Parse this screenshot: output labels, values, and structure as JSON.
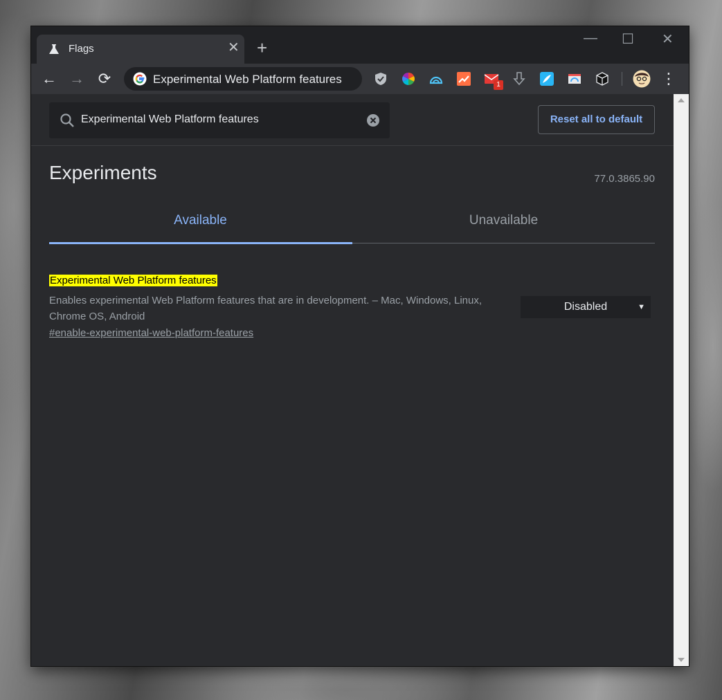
{
  "tab": {
    "title": "Flags",
    "close_glyph": "✕"
  },
  "newtab_glyph": "+",
  "window_controls": {
    "minimize": "—",
    "maximize": "☐",
    "close": "✕"
  },
  "toolbar": {
    "back": "←",
    "forward": "→",
    "reload": "⟳",
    "omnibox_text": "Experimental Web Platform features",
    "menu": "⋮",
    "mail_badge": "1"
  },
  "search": {
    "value": "Experimental Web Platform features"
  },
  "reset_label": "Reset all to default",
  "page_title": "Experiments",
  "version": "77.0.3865.90",
  "tabs": {
    "available": "Available",
    "unavailable": "Unavailable"
  },
  "flag": {
    "name": "Experimental Web Platform features",
    "description": "Enables experimental Web Platform features that are in development. – Mac, Windows, Linux, Chrome OS, Android",
    "link": "#enable-experimental-web-platform-features",
    "selected": "Disabled"
  },
  "colors": {
    "accent": "#8ab4f8",
    "highlight": "#ffff00",
    "background": "#292a2d"
  }
}
